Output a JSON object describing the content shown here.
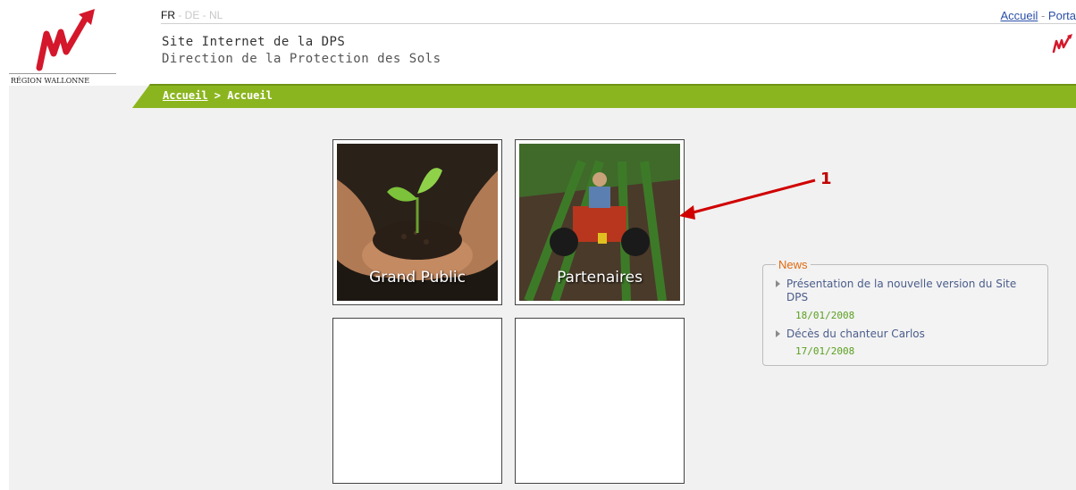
{
  "header": {
    "logo_text": "RÉGION WALLONNE",
    "languages": [
      {
        "label": "FR",
        "active": true
      },
      {
        "label": "DE",
        "active": false
      },
      {
        "label": "NL",
        "active": false
      }
    ],
    "lang_separator": " - ",
    "title_line1": "Site Internet de la DPS",
    "title_line2": "Direction de la Protection des Sols",
    "top_links": {
      "home": "Accueil",
      "dash": " - ",
      "portal": "Porta"
    }
  },
  "breadcrumb": {
    "link": "Accueil",
    "separator": " > ",
    "current": "Accueil"
  },
  "tiles": [
    {
      "label": "Grand Public",
      "icon": "hands-soil-seedling-image"
    },
    {
      "label": "Partenaires",
      "icon": "tractor-field-image"
    },
    {
      "label": "",
      "icon": ""
    },
    {
      "label": "",
      "icon": ""
    }
  ],
  "news": {
    "title": "News",
    "items": [
      {
        "text": "Présentation de la nouvelle version du Site DPS",
        "date": "18/01/2008"
      },
      {
        "text": "Décès du chanteur Carlos",
        "date": "17/01/2008"
      }
    ]
  },
  "annotation": {
    "number": "1",
    "color": "#d00000"
  },
  "colors": {
    "accent_green": "#8bb51e",
    "logo_red": "#d4172b",
    "news_title": "#e06a10",
    "date_green": "#5aa020"
  }
}
